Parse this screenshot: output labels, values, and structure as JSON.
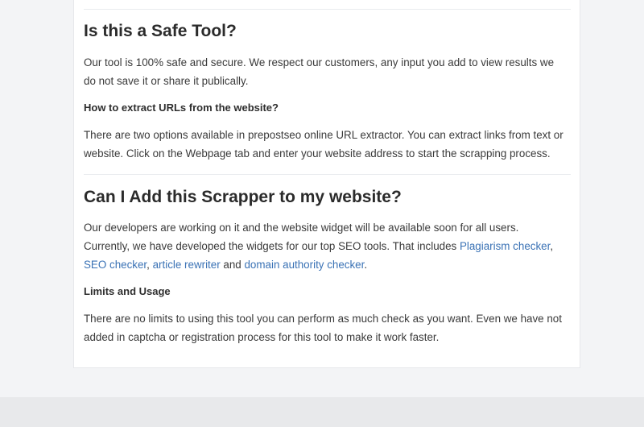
{
  "section1": {
    "title": "Is this a Safe Tool?",
    "paragraph": "Our tool is 100% safe and secure. We respect our customers, any input you add to view results we do not save it or share it publically.",
    "subheading": "How to extract URLs from the website?",
    "answer": "There are two options available in prepostseo online URL extractor. You can extract links from text or website. Click on the Webpage tab and enter your website address to start the scrapping process."
  },
  "section2": {
    "title": "Can I Add this Scrapper to my website?",
    "paragraph_intro": "Our developers are working on it and the website widget will be available soon for all users. Currently, we have developed the widgets for our top SEO tools. That includes ",
    "link_plagiarism": "Plagiarism checker",
    "sep_comma1": ", ",
    "link_seo": "SEO checker",
    "sep_comma2": ", ",
    "link_rewriter": "article rewriter",
    "sep_and": " and ",
    "link_domain": "domain authority checker",
    "end_period": ".",
    "subheading": "Limits and Usage",
    "answer": "There are no limits to using this tool you can perform as much check as you want. Even we have not added in captcha or registration process for this tool to make it work faster."
  },
  "colors": {
    "link": "#3a72b5",
    "background": "#f3f4f6",
    "card": "#ffffff"
  }
}
